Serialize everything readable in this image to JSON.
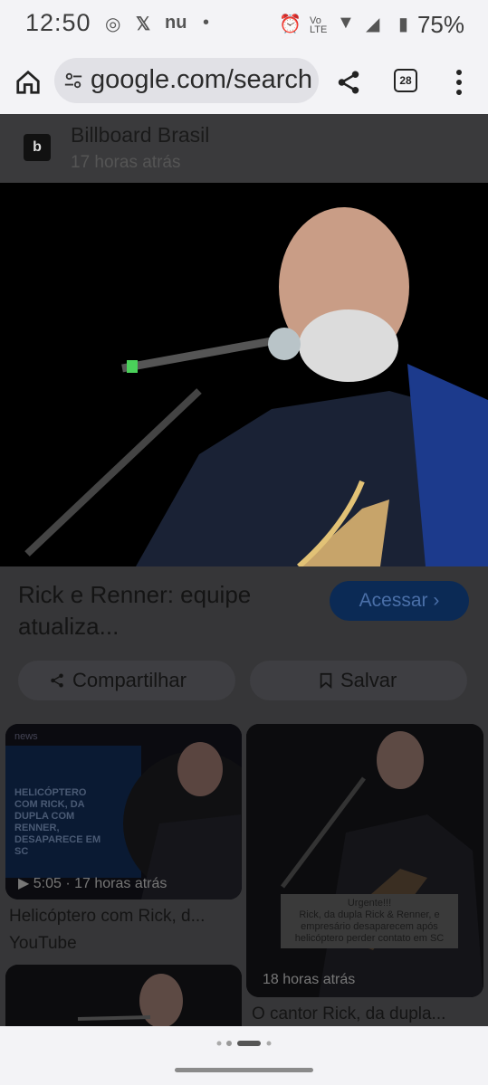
{
  "status": {
    "time": "12:50",
    "battery": "75%",
    "icons": [
      "whatsapp-icon",
      "x-icon",
      "nu-icon",
      "dot-icon",
      "alarm-icon",
      "volte-icon",
      "wifi-icon",
      "signal-icon",
      "battery-icon"
    ]
  },
  "browser": {
    "url": "google.com/search",
    "tabs_count": "28"
  },
  "source": {
    "logo": "b",
    "name": "Billboard Brasil",
    "time": "17 horas atrás"
  },
  "article": {
    "title": "Rick e Renner: equipe atualiza...",
    "acessar": "Acessar ›",
    "share": "Compartilhar",
    "save": "Salvar"
  },
  "related": [
    {
      "overlay": "HELICÓPTERO COM RICK, DA DUPLA COM RENNER, DESAPARECE EM SC",
      "duration": "▶ 5:05 · 17 horas atrás",
      "title": "Helicóptero com Rick, d...",
      "source": "YouTube",
      "brand": "news"
    },
    {
      "overlay": "Urgente!!!\nRick, da dupla Rick & Renner, e empresário desaparecem após helicóptero perder contato em SC",
      "time": "18 horas atrás",
      "title": "O cantor Rick, da dupla..."
    }
  ]
}
